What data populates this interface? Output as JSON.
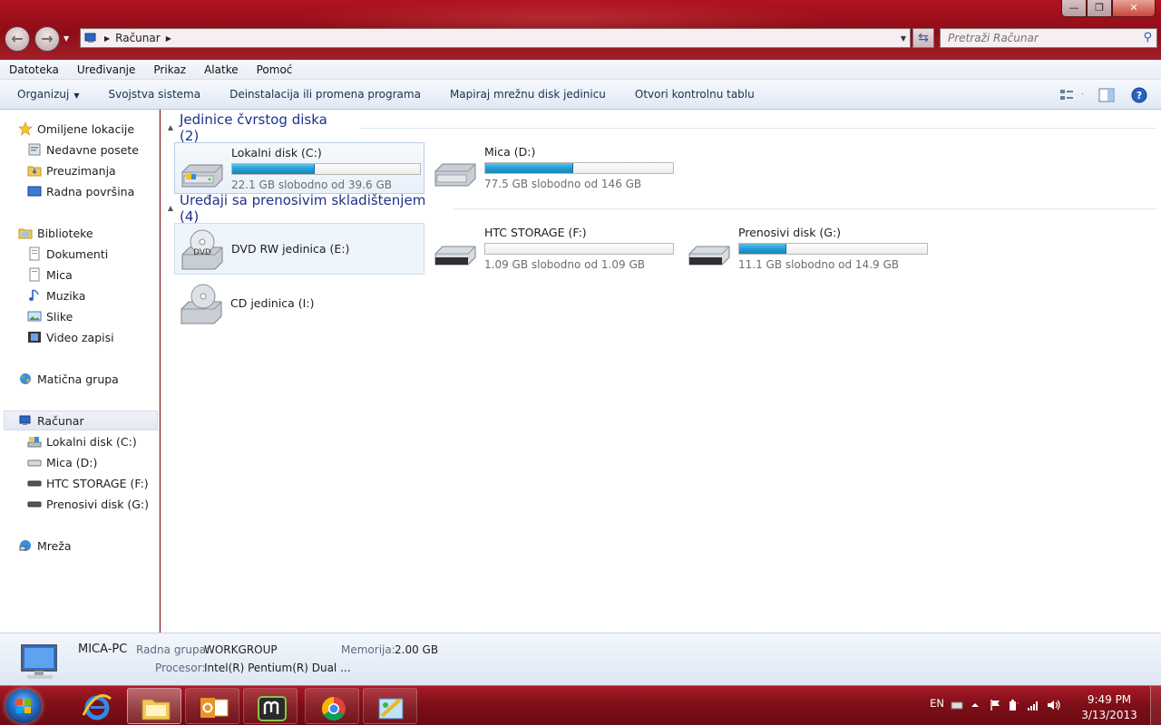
{
  "window": {
    "controls": {
      "minimize": "—",
      "maximize": "❐",
      "close": "✕"
    }
  },
  "address": {
    "path": [
      "Računar"
    ],
    "search_placeholder": "Pretraži Računar"
  },
  "menubar": [
    "Datoteka",
    "Uređivanje",
    "Prikaz",
    "Alatke",
    "Pomoć"
  ],
  "toolbar": {
    "organize": "Organizuj",
    "items": [
      "Svojstva sistema",
      "Deinstalacija ili promena programa",
      "Mapiraj mrežnu disk jedinicu",
      "Otvori kontrolnu tablu"
    ]
  },
  "nav": {
    "favorites": {
      "label": "Omiljene lokacije",
      "items": [
        "Nedavne posete",
        "Preuzimanja",
        "Radna površina"
      ]
    },
    "libraries": {
      "label": "Biblioteke",
      "items": [
        "Dokumenti",
        "Mica",
        "Muzika",
        "Slike",
        "Video zapisi"
      ]
    },
    "homegroup": {
      "label": "Matična grupa"
    },
    "computer": {
      "label": "Računar",
      "items": [
        "Lokalni disk (C:)",
        "Mica (D:)",
        "HTC STORAGE (F:)",
        "Prenosivi disk (G:)"
      ]
    },
    "network": {
      "label": "Mreža"
    }
  },
  "groups": {
    "hdd": {
      "title": "Jedinice čvrstog diska (2)"
    },
    "removable": {
      "title": "Uređaji sa prenosivim skladištenjem (4)"
    }
  },
  "drives": {
    "c": {
      "name": "Lokalni disk (C:)",
      "free": "22.1 GB slobodno od 39.6 GB",
      "used_fraction": 0.44
    },
    "d": {
      "name": "Mica (D:)",
      "free": "77.5 GB slobodno od 146 GB",
      "used_fraction": 0.47
    },
    "e": {
      "name": "DVD RW jedinica (E:)",
      "disc_label": "DVD"
    },
    "f": {
      "name": "HTC STORAGE (F:)",
      "free": "1.09 GB slobodno od 1.09 GB",
      "used_fraction": 0.0
    },
    "g": {
      "name": "Prenosivi disk (G:)",
      "free": "11.1 GB slobodno od 14.9 GB",
      "used_fraction": 0.25
    },
    "i": {
      "name": "CD jedinica (I:)"
    }
  },
  "details": {
    "pc_name": "MICA-PC",
    "workgroup_label": "Radna grupa:",
    "workgroup": "WORKGROUP",
    "memory_label": "Memorija:",
    "memory": "2.00 GB",
    "cpu_label": "Procesor:",
    "cpu": "Intel(R) Pentium(R) Dual  ..."
  },
  "taskbar": {
    "lang": "EN",
    "time": "9:49 PM",
    "date": "3/13/2013"
  },
  "colors": {
    "accent": "#1e3287",
    "progress": "#26a0da",
    "taskbar": "#7d0e17"
  }
}
